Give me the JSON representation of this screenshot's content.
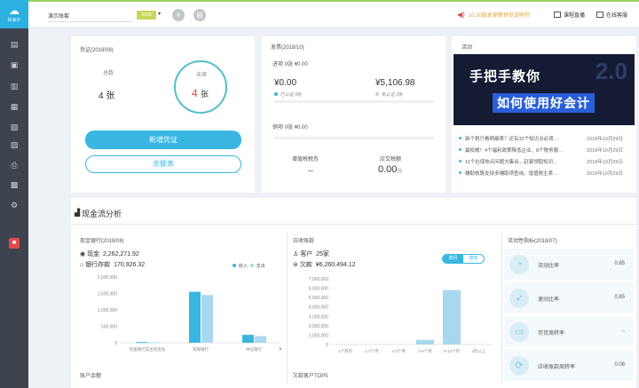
{
  "app": {
    "logo_label": "账",
    "logo_sub": "好会计"
  },
  "sidebar": {
    "icons": [
      "document-icon",
      "voucher-icon",
      "chart-icon",
      "ledger-icon",
      "report-icon",
      "invoice-icon",
      "print-icon",
      "tax-icon",
      "settings-icon"
    ],
    "bottom_icon": "gift-icon"
  },
  "topbar": {
    "account_name": "演示账套",
    "period_label": "2018",
    "notice": "10.30版本更新预览说明书",
    "course_btn": "课程直播",
    "service_btn": "在线客服",
    "add_icon": "+",
    "more_icon": "⊞"
  },
  "voucher": {
    "title": "凭证(2018/08)",
    "total_label": "总数",
    "total_value": "4 张",
    "unaudited_label": "未审",
    "unaudited_value": "4",
    "unaudited_unit": "张",
    "new_button": "新增凭证",
    "balance_button": "余额表"
  },
  "invoice": {
    "title": "发票(2018/10)",
    "in_label": "进项",
    "in_count": "0张",
    "in_amount": "¥0.00",
    "in_total": "¥0.00",
    "certified_label": "已认证",
    "certified_count": "0张",
    "out_total": "¥5,106.98",
    "uncertified_label": "未认证",
    "uncertified_count": "2张",
    "sales_label": "销项",
    "sales_count": "0张",
    "sales_amount": "¥0.00",
    "tax_label": "增值税税负",
    "tax_value": "--",
    "payable_label": "应交税额",
    "payable_value": "0.00",
    "payable_unit": "元"
  },
  "activity": {
    "title": "活动",
    "banner_line1": "手把手教你",
    "banner_line2": "如何使用好会计",
    "banner_badge": "2.0",
    "news": [
      {
        "text": "新个税只看明细表？还有32个知识点必须…",
        "date": "2018年10月29日"
      },
      {
        "text": "最权威！4个福利政策降低企业、8个税务服…",
        "date": "2018年10月29日"
      },
      {
        "text": "11个社保热点问题大集合，赶紧领取知识…",
        "date": "2018年10月29日"
      },
      {
        "text": "辅助核算支持多辅助项查询，增值税主表…",
        "date": "2018年10月29日"
      }
    ]
  },
  "cashflow": {
    "section_title": "现金流分析",
    "bank": {
      "title": "现金银行(2018/08)",
      "cash_label": "现金",
      "cash_value": "2,262,271.92",
      "deposit_label": "银行存款",
      "deposit_value": "170,926.32",
      "legend_in": "收入",
      "legend_out": "支出",
      "more": ">"
    },
    "receivable": {
      "title": "应收账款",
      "customer_label": "客户",
      "customer_value": "25家",
      "amount_label": "欠款",
      "amount_value": "¥6,260,494.12",
      "toggle_on": "按月",
      "toggle_off": "按年"
    },
    "indicators": {
      "title": "流动性指标(2018/07)",
      "items": [
        {
          "icon": "gauge-icon",
          "label": "流动比率",
          "value": "0.85"
        },
        {
          "icon": "rocket-icon",
          "label": "速动比率",
          "value": "0.85"
        },
        {
          "icon": "box-icon",
          "label": "存货周转率",
          "value": "--"
        },
        {
          "icon": "cycle-icon",
          "label": "应收账款周转率",
          "value": "0.06"
        }
      ]
    },
    "bottom_left_title": "账户余额",
    "bottom_mid_title": "欠款客户TOP5"
  },
  "colors": {
    "accent": "#39b6e0",
    "income": "#39b6e0",
    "expense": "#a7d8ef",
    "alert": "#e04a4a"
  },
  "chart_data": [
    {
      "type": "bar",
      "title": "",
      "categories": [
        "现金银行支出及变动",
        "有限银行",
        "中信银行"
      ],
      "series": [
        {
          "name": "收入",
          "values": [
            20000,
            1550000,
            240000
          ]
        },
        {
          "name": "支出",
          "values": [
            15000,
            1450000,
            200000
          ]
        }
      ],
      "extra": [
        {
          "category_index": 0,
          "values": [
            0,
            0
          ]
        }
      ],
      "yticks": [
        "2,000,000",
        "1,500,000",
        "1,000,000",
        "500,000",
        "0"
      ],
      "ylim": [
        0,
        2000000
      ]
    },
    {
      "type": "bar",
      "title": "",
      "categories": [
        "1个月内",
        "1-2个月",
        "2-3个月",
        "3-6个月",
        "6-12个月",
        "1年以上"
      ],
      "values": [
        0,
        0,
        0,
        500000,
        5800000,
        0
      ],
      "yticks": [
        "7,000,000",
        "6,000,000",
        "5,000,000",
        "4,000,000",
        "3,000,000",
        "2,000,000",
        "1,000,000",
        "0"
      ],
      "ylim": [
        0,
        7000000
      ]
    }
  ]
}
